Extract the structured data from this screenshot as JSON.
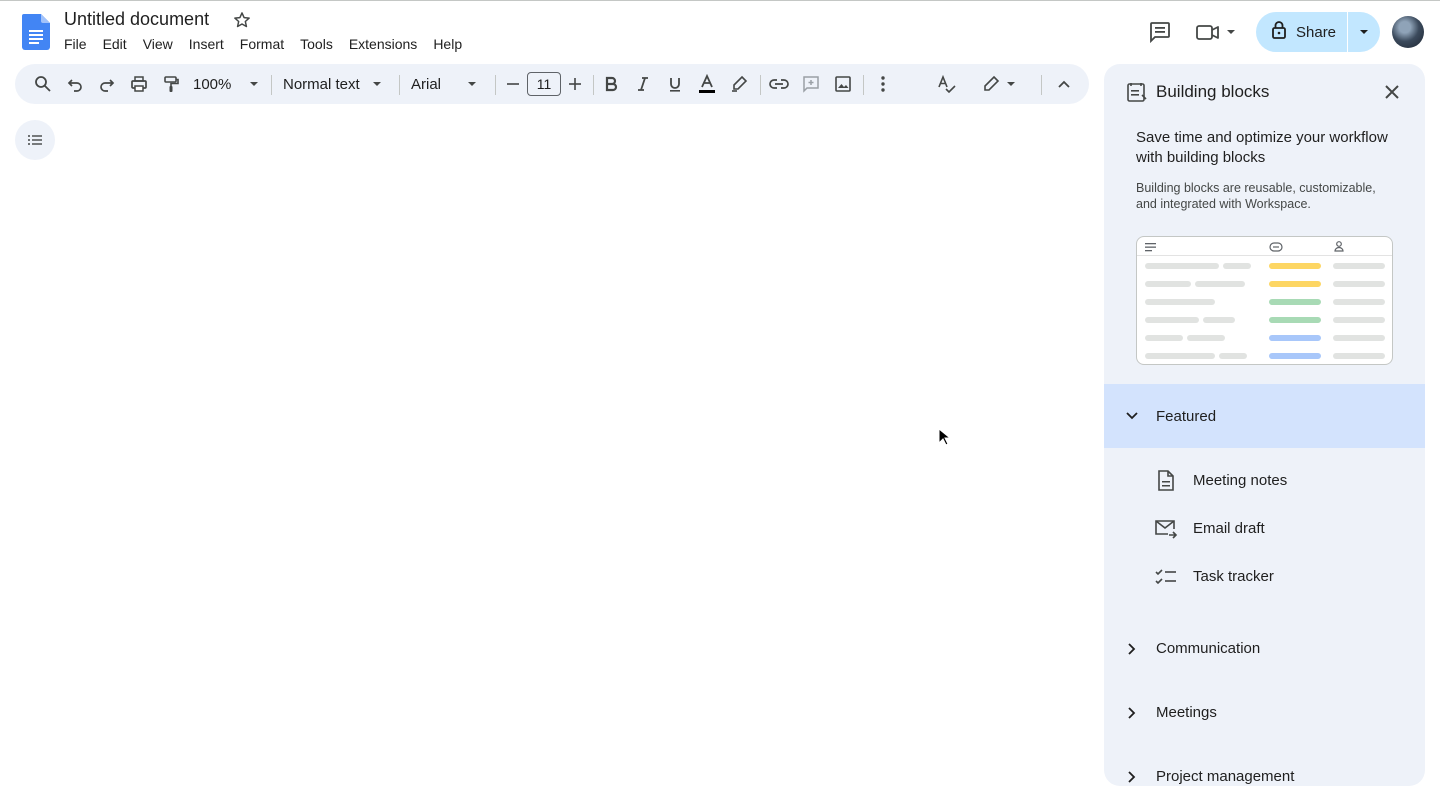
{
  "document": {
    "title": "Untitled document",
    "menu": [
      "File",
      "Edit",
      "View",
      "Insert",
      "Format",
      "Tools",
      "Extensions",
      "Help"
    ]
  },
  "header": {
    "share_label": "Share",
    "icons": [
      "comments-icon",
      "meet-icon",
      "lock-icon",
      "avatar"
    ]
  },
  "toolbar": {
    "zoom": "100%",
    "style": "Normal text",
    "font": "Arial",
    "font_size": "11"
  },
  "panel": {
    "title": "Building blocks",
    "heading": "Save time and optimize your workflow with building blocks",
    "description": "Building blocks are reusable, customizable, and integrated with Workspace.",
    "sections": [
      {
        "label": "Featured",
        "expanded": true,
        "items": [
          {
            "label": "Meeting notes",
            "icon": "document-icon"
          },
          {
            "label": "Email draft",
            "icon": "email-send-icon"
          },
          {
            "label": "Task tracker",
            "icon": "checklist-icon"
          }
        ]
      },
      {
        "label": "Communication",
        "expanded": false
      },
      {
        "label": "Meetings",
        "expanded": false
      },
      {
        "label": "Project management",
        "expanded": false
      }
    ]
  },
  "colors": {
    "accent": "#0b57d0",
    "toolbar_bg": "#eef2f9",
    "panel_bg": "#eef2f9",
    "featured_bg": "#d3e3fd",
    "share_bg": "#c2e7ff",
    "docs_blue": "#4285f4",
    "preview_yellow": "#fdd663",
    "preview_green": "#a8dab5",
    "preview_blue": "#a8c7fa"
  }
}
